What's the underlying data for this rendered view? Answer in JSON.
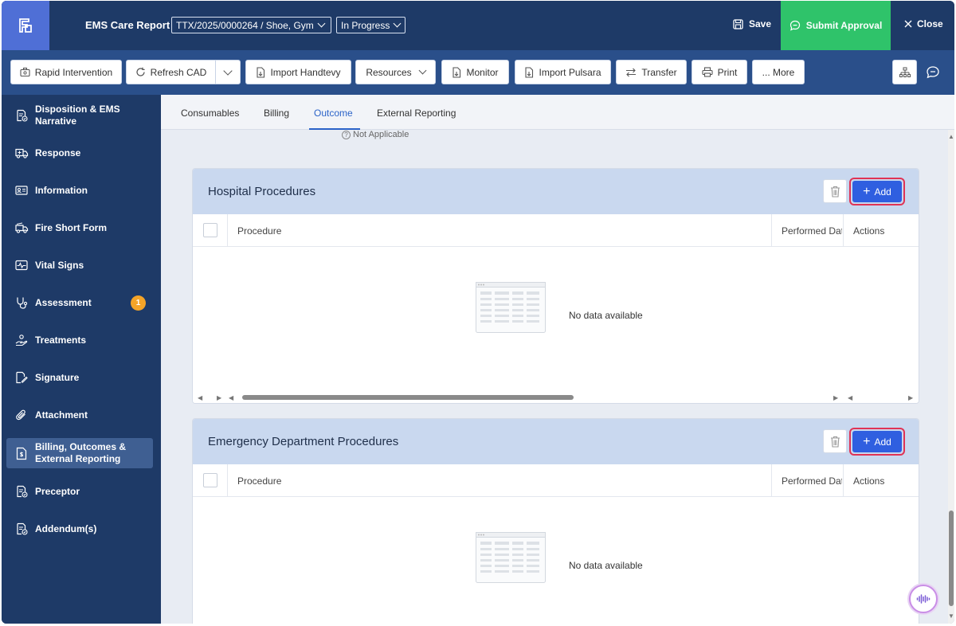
{
  "header": {
    "app_title": "EMS Care Report",
    "record_select": "TTX/2025/0000264 / Shoe, Gym",
    "status_select": "In Progress",
    "save_label": "Save",
    "submit_label": "Submit Approval",
    "close_label": "Close",
    "accent_color": "#2fc36a"
  },
  "toolbar": {
    "rapid_intervention": "Rapid Intervention",
    "refresh_cad": "Refresh CAD",
    "import_handtevy": "Import Handtevy",
    "resources": "Resources",
    "monitor": "Monitor",
    "import_pulsara": "Import Pulsara",
    "transfer": "Transfer",
    "print": "Print",
    "more": "... More"
  },
  "sidebar": {
    "items": [
      {
        "label_line1": "Disposition & EMS",
        "label_line2": "Narrative",
        "icon": "document-check-icon"
      },
      {
        "label": "Response",
        "icon": "ambulance-icon"
      },
      {
        "label": "Information",
        "icon": "id-card-icon"
      },
      {
        "label": "Fire Short Form",
        "icon": "fire-truck-icon"
      },
      {
        "label": "Vital Signs",
        "icon": "pulse-icon"
      },
      {
        "label": "Assessment",
        "icon": "stethoscope-icon",
        "badge": "1"
      },
      {
        "label": "Treatments",
        "icon": "hand-care-icon"
      },
      {
        "label": "Signature",
        "icon": "signature-icon"
      },
      {
        "label": "Attachment",
        "icon": "paperclip-icon"
      },
      {
        "label_line1": "Billing, Outcomes &",
        "label_line2": "External Reporting",
        "icon": "billing-icon",
        "active": true
      },
      {
        "label": "Preceptor",
        "icon": "document-check-icon"
      },
      {
        "label": "Addendum(s)",
        "icon": "document-check-icon"
      }
    ]
  },
  "tabs": [
    "Consumables",
    "Billing",
    "Outcome",
    "External Reporting"
  ],
  "active_tab": "Outcome",
  "not_applicable": "Not Applicable",
  "sections": [
    {
      "title": "Hospital Procedures",
      "add_label": "Add",
      "columns": [
        "Procedure",
        "Performed Dat",
        "Actions"
      ],
      "empty_text": "No data available"
    },
    {
      "title": "Emergency Department Procedures",
      "add_label": "Add",
      "columns": [
        "Procedure",
        "Performed Dat",
        "Actions"
      ],
      "empty_text": "No data available"
    }
  ]
}
